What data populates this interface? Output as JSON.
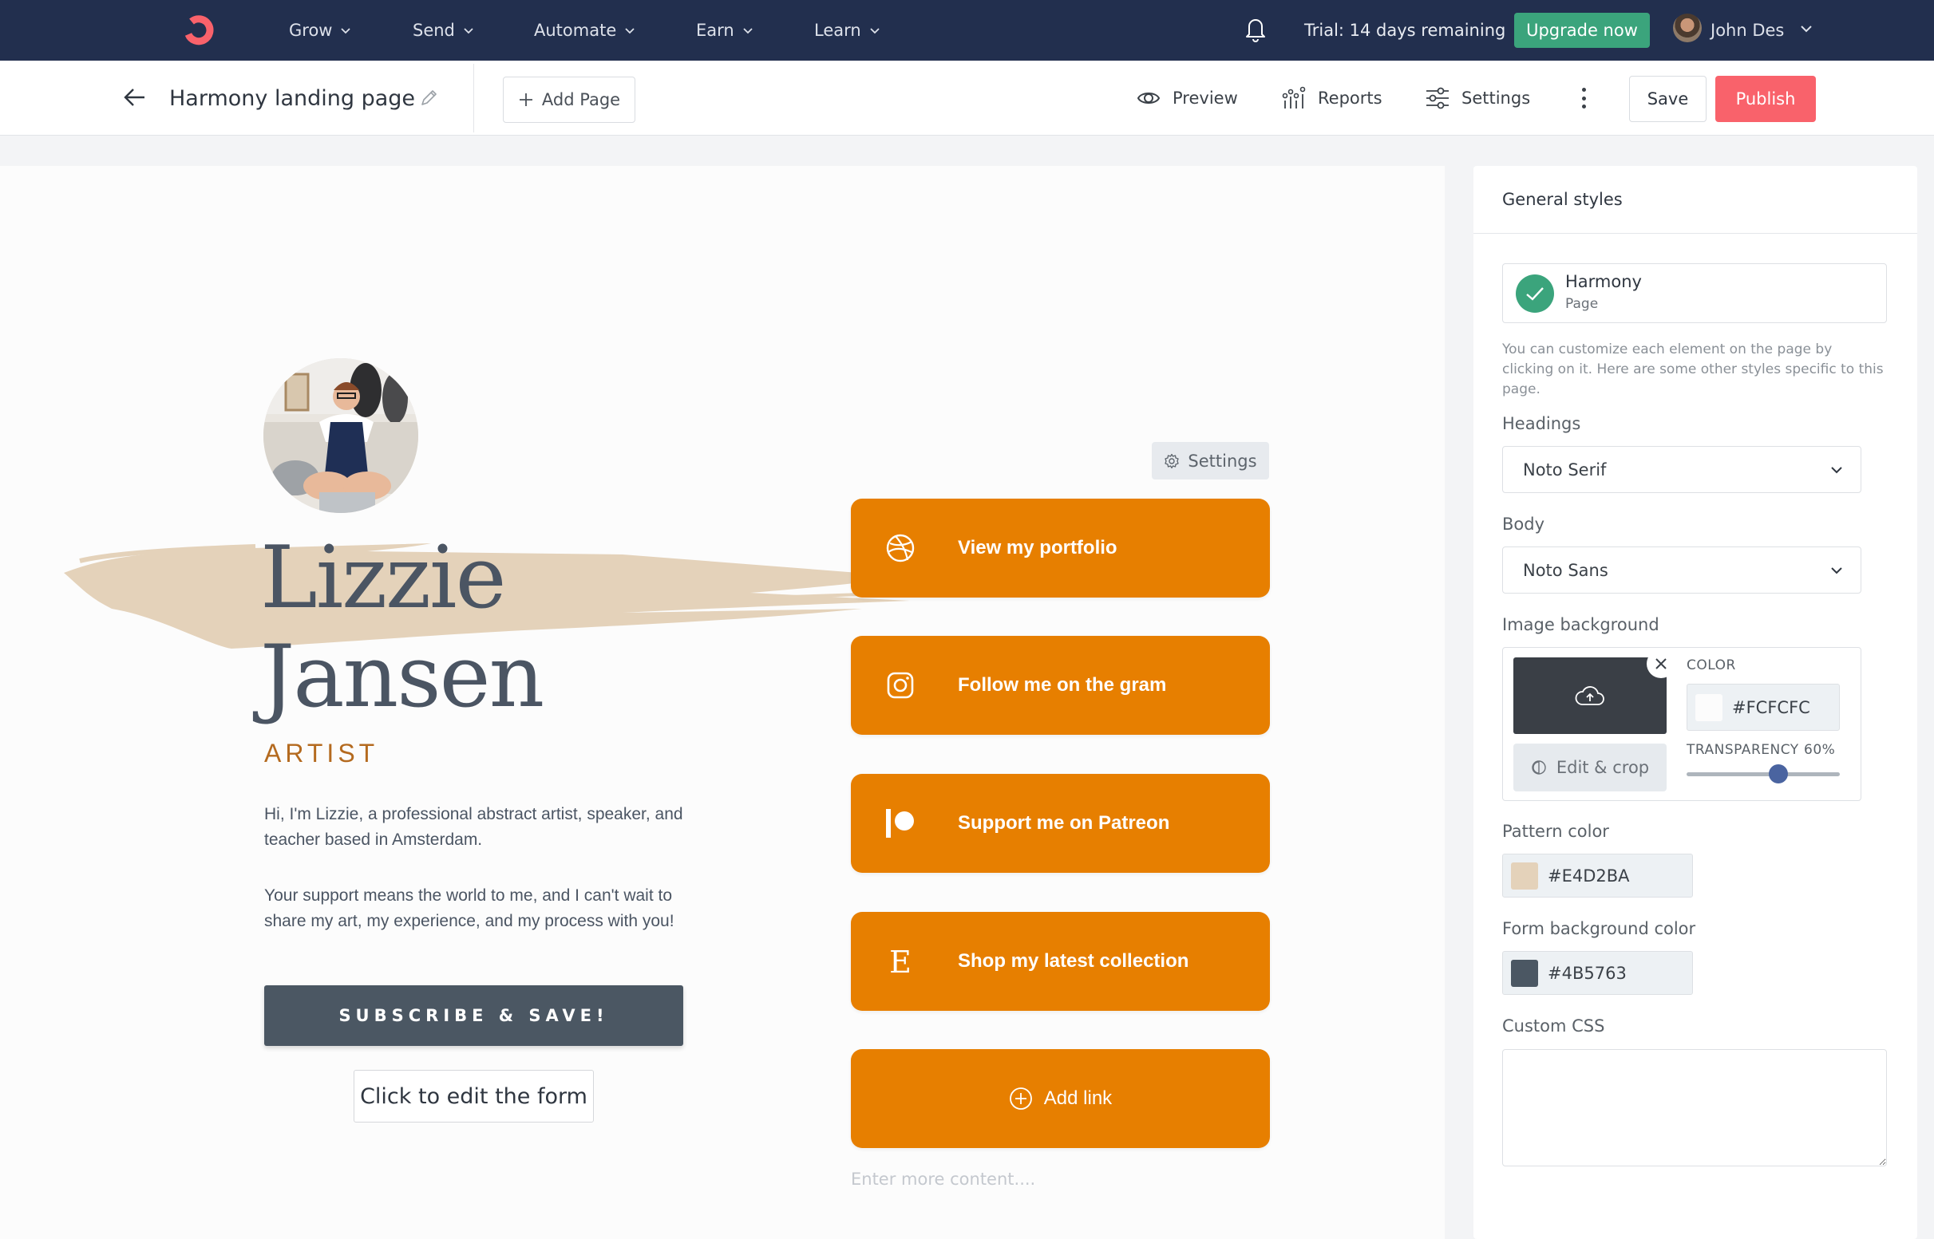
{
  "topnav": {
    "menu": [
      {
        "label": "Grow"
      },
      {
        "label": "Send"
      },
      {
        "label": "Automate"
      },
      {
        "label": "Earn"
      },
      {
        "label": "Learn"
      }
    ],
    "trial_text": "Trial: 14 days remaining",
    "upgrade_label": "Upgrade now",
    "user_name": "John Des",
    "brand_color": "#F9626B",
    "bg_color": "#222F4E"
  },
  "toolbar": {
    "page_title": "Harmony landing page",
    "add_page_label": "Add Page",
    "preview_label": "Preview",
    "reports_label": "Reports",
    "settings_label": "Settings",
    "save_label": "Save",
    "publish_label": "Publish"
  },
  "canvas": {
    "name_line1": "Lizzie",
    "name_line2": "Jansen",
    "role": "ARTIST",
    "bio_1": "Hi, I'm Lizzie, a professional abstract artist, speaker, and teacher based in Amsterdam.",
    "bio_2": "Your support means the world to me, and I can't wait to share my art, my experience, and my process with you!",
    "subscribe_label": "SUBSCRIBE & SAVE!",
    "edit_form_label": "Click to edit the form",
    "settings_label": "Settings",
    "links": [
      {
        "label": "View my portfolio",
        "icon": "dribbble-icon"
      },
      {
        "label": "Follow me on the gram",
        "icon": "instagram-icon"
      },
      {
        "label": "Support me on Patreon",
        "icon": "patreon-icon"
      },
      {
        "label": "Shop my latest collection",
        "icon": "etsy-icon"
      }
    ],
    "add_link_label": "Add link",
    "more_content_placeholder": "Enter more content....",
    "button_color": "#E77F00"
  },
  "panel": {
    "title": "General styles",
    "theme_name": "Harmony",
    "theme_type": "Page",
    "help_text": "You can customize each element on the page by clicking on it. Here are some other styles specific to this page.",
    "headings_label": "Headings",
    "headings_value": "Noto Serif",
    "body_label": "Body",
    "body_value": "Noto Sans",
    "image_bg_label": "Image background",
    "color_label": "COLOR",
    "color_value": "#FCFCFC",
    "transparency_label": "TRANSPARENCY",
    "transparency_value": "60%",
    "transparency_fraction": 0.6,
    "edit_crop_label": "Edit & crop",
    "pattern_color_label": "Pattern color",
    "pattern_color_value": "#E4D2BA",
    "form_bg_label": "Form background color",
    "form_bg_value": "#4B5763",
    "custom_css_label": "Custom CSS",
    "custom_css_value": ""
  }
}
